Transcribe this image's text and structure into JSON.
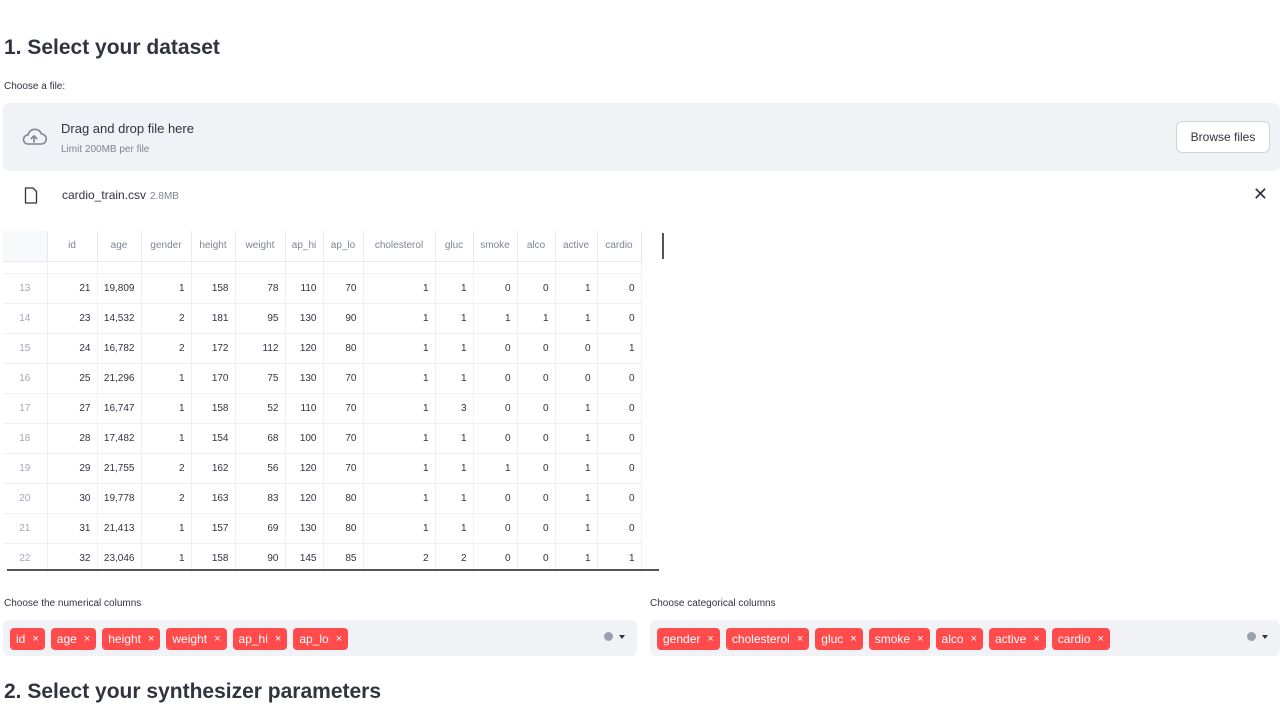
{
  "section1": {
    "title": "1. Select your dataset",
    "file_label": "Choose a file:"
  },
  "uploader": {
    "drop_text": "Drag and drop file here",
    "limit_text": "Limit 200MB per file",
    "browse_label": "Browse files"
  },
  "file": {
    "name": "cardio_train.csv",
    "size": "2.8MB",
    "close": "✕"
  },
  "table": {
    "columns": [
      "",
      "id",
      "age",
      "gender",
      "height",
      "weight",
      "ap_hi",
      "ap_lo",
      "cholesterol",
      "gluc",
      "smoke",
      "alco",
      "active",
      "cardio"
    ],
    "rows": [
      [
        "13",
        "21",
        "19,809",
        "1",
        "158",
        "78",
        "110",
        "70",
        "1",
        "1",
        "0",
        "0",
        "1",
        "0"
      ],
      [
        "14",
        "23",
        "14,532",
        "2",
        "181",
        "95",
        "130",
        "90",
        "1",
        "1",
        "1",
        "1",
        "1",
        "0"
      ],
      [
        "15",
        "24",
        "16,782",
        "2",
        "172",
        "112",
        "120",
        "80",
        "1",
        "1",
        "0",
        "0",
        "0",
        "1"
      ],
      [
        "16",
        "25",
        "21,296",
        "1",
        "170",
        "75",
        "130",
        "70",
        "1",
        "1",
        "0",
        "0",
        "0",
        "0"
      ],
      [
        "17",
        "27",
        "16,747",
        "1",
        "158",
        "52",
        "110",
        "70",
        "1",
        "3",
        "0",
        "0",
        "1",
        "0"
      ],
      [
        "18",
        "28",
        "17,482",
        "1",
        "154",
        "68",
        "100",
        "70",
        "1",
        "1",
        "0",
        "0",
        "1",
        "0"
      ],
      [
        "19",
        "29",
        "21,755",
        "2",
        "162",
        "56",
        "120",
        "70",
        "1",
        "1",
        "1",
        "0",
        "1",
        "0"
      ],
      [
        "20",
        "30",
        "19,778",
        "2",
        "163",
        "83",
        "120",
        "80",
        "1",
        "1",
        "0",
        "0",
        "1",
        "0"
      ],
      [
        "21",
        "31",
        "21,413",
        "1",
        "157",
        "69",
        "130",
        "80",
        "1",
        "1",
        "0",
        "0",
        "1",
        "0"
      ],
      [
        "22",
        "32",
        "23,046",
        "1",
        "158",
        "90",
        "145",
        "85",
        "2",
        "2",
        "0",
        "0",
        "1",
        "1"
      ]
    ]
  },
  "numerical": {
    "label": "Choose the numerical columns",
    "chips": [
      "id",
      "age",
      "height",
      "weight",
      "ap_hi",
      "ap_lo"
    ]
  },
  "categorical": {
    "label": "Choose categorical columns",
    "chips": [
      "gender",
      "cholesterol",
      "gluc",
      "smoke",
      "alco",
      "active",
      "cardio"
    ]
  },
  "section2": {
    "title": "2. Select your synthesizer parameters"
  },
  "chip_remove": "×",
  "colors": {
    "accent": "#ff4b4b",
    "panel": "#f0f2f6",
    "text": "#31333f"
  },
  "icons": [
    "cloud-upload-icon",
    "file-icon",
    "close-icon",
    "clear-icon",
    "chevron-down-icon"
  ]
}
